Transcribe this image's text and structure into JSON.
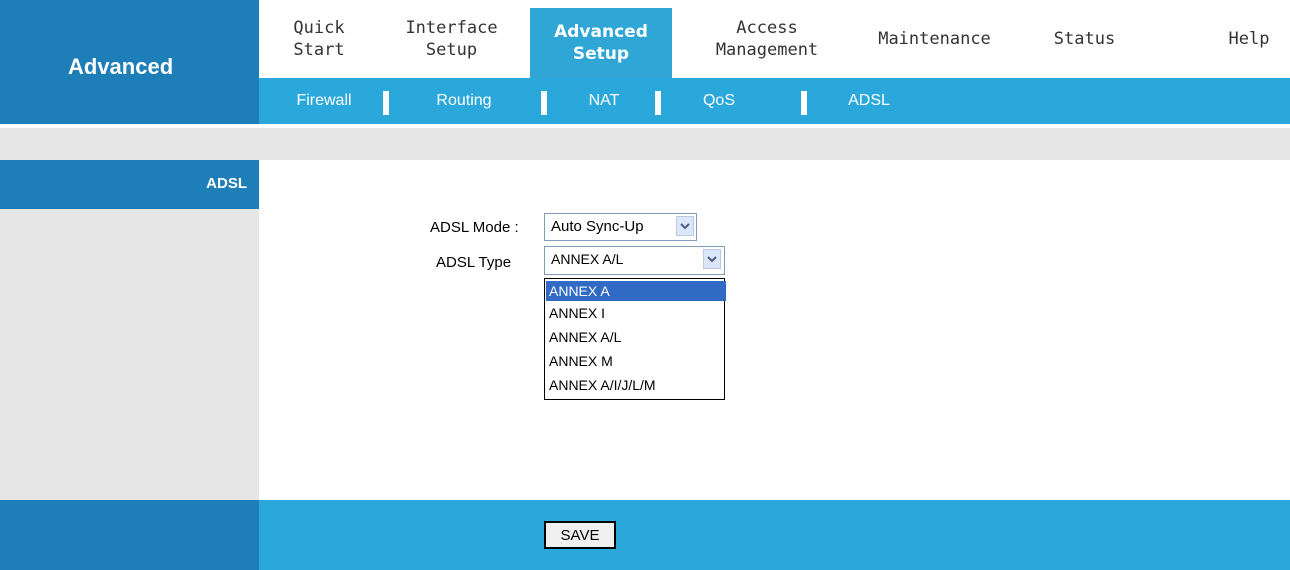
{
  "section_title": "Advanced",
  "main_nav": [
    {
      "line1": "Quick",
      "line2": "Start"
    },
    {
      "line1": "Interface",
      "line2": "Setup"
    },
    {
      "line1": "Advanced",
      "line2": "Setup"
    },
    {
      "line1": "Access",
      "line2": "Management"
    },
    {
      "line1": "Maintenance",
      "line2": ""
    },
    {
      "line1": "Status",
      "line2": ""
    },
    {
      "line1": "Help",
      "line2": ""
    }
  ],
  "sub_nav": [
    "Firewall",
    "Routing",
    "NAT",
    "QoS",
    "ADSL"
  ],
  "sidebar": {
    "section_label": "ADSL"
  },
  "form": {
    "adsl_mode": {
      "label": "ADSL Mode :",
      "value": "Auto Sync-Up"
    },
    "adsl_type": {
      "label": "ADSL Type",
      "value": "ANNEX A/L",
      "options": [
        "ANNEX A",
        "ANNEX I",
        "ANNEX A/L",
        "ANNEX M",
        "ANNEX A/I/J/L/M"
      ],
      "highlighted_option": "ANNEX A"
    }
  },
  "footer": {
    "save_label": "SAVE"
  },
  "colors": {
    "dark_blue": "#1e7eb8",
    "light_blue": "#2aa8dc",
    "grey": "#e6e6e6",
    "highlight": "#316ac5"
  }
}
